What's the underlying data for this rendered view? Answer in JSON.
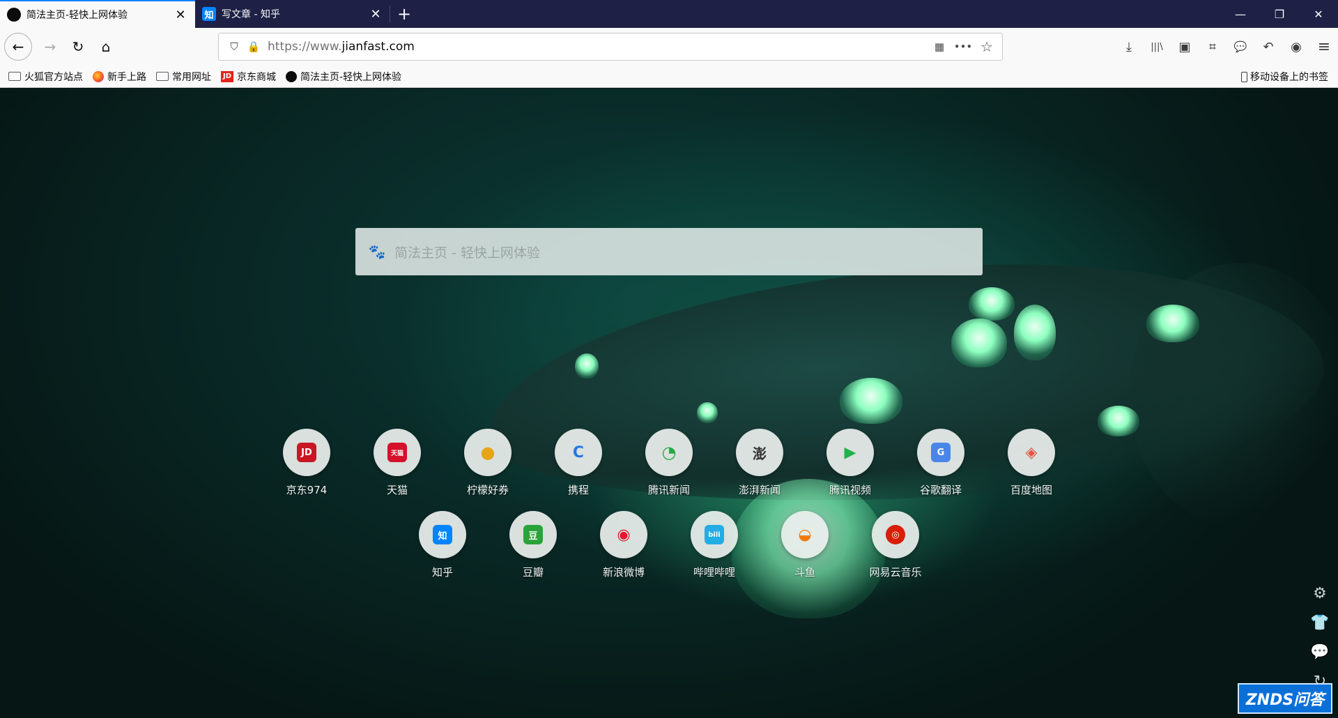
{
  "tabs": [
    {
      "title": "简法主页-轻快上网体验",
      "favicon": "jianfa-icon",
      "favicon_text": "",
      "active": true
    },
    {
      "title": "写文章 - 知乎",
      "favicon": "zhihu-icon",
      "favicon_text": "知",
      "active": false
    }
  ],
  "tab_close_glyph": "✕",
  "new_tab_glyph": "+",
  "window_controls": {
    "minimize": "—",
    "restore": "❐",
    "close": "✕"
  },
  "nav": {
    "back": "←",
    "forward": "→",
    "reload": "↻",
    "home": "⌂",
    "url_prefix": "https://www.",
    "url_domain": "jianfast.com",
    "shield": "⛉",
    "lock": "🔒",
    "qr": "▦",
    "more": "•••",
    "star": "☆"
  },
  "toolbar_right": {
    "download": "⤓",
    "library": "|||\\",
    "sidebar": "▣",
    "crop": "⌗",
    "chat": "💬",
    "undo": "↶",
    "account": "◉",
    "menu": "≡"
  },
  "bookmarks": [
    {
      "label": "火狐官方站点",
      "icon": "folder-icon",
      "icon_text": ""
    },
    {
      "label": "新手上路",
      "icon": "firefox-icon",
      "icon_text": ""
    },
    {
      "label": "常用网址",
      "icon": "folder-icon",
      "icon_text": ""
    },
    {
      "label": "京东商城",
      "icon": "jd-icon",
      "icon_text": "JD"
    },
    {
      "label": "简法主页-轻快上网体验",
      "icon": "jianfa-icon",
      "icon_text": ""
    }
  ],
  "mobile_bookmarks": "移动设备上的书签",
  "search": {
    "placeholder": "简法主页 - 轻快上网体验",
    "paw": "🐾"
  },
  "sites_row1": [
    {
      "label": "京东974",
      "glyph": "JD",
      "color": "#c81623"
    },
    {
      "label": "天猫",
      "glyph": "天猫",
      "color": "#d5102a"
    },
    {
      "label": "柠檬好券",
      "glyph": "●",
      "color": "#e6a516"
    },
    {
      "label": "携程",
      "glyph": "C",
      "color": "#2577e3"
    },
    {
      "label": "腾讯新闻",
      "glyph": "◔",
      "color": "#27a745"
    },
    {
      "label": "澎湃新闻",
      "glyph": "澎",
      "color": "#333333"
    },
    {
      "label": "腾讯视频",
      "glyph": "▶",
      "color": "#20b24b"
    },
    {
      "label": "谷歌翻译",
      "glyph": "G",
      "color": "#4a86e8"
    },
    {
      "label": "百度地图",
      "glyph": "◈",
      "color": "#e5533d"
    }
  ],
  "sites_row2": [
    {
      "label": "知乎",
      "glyph": "知",
      "color": "#0084ff"
    },
    {
      "label": "豆瓣",
      "glyph": "豆",
      "color": "#2aa33a"
    },
    {
      "label": "新浪微博",
      "glyph": "◉",
      "color": "#e6162d"
    },
    {
      "label": "哔哩哔哩",
      "glyph": "bili",
      "color": "#23ade5"
    },
    {
      "label": "斗鱼",
      "glyph": "◒",
      "color": "#f07a10"
    },
    {
      "label": "网易云音乐",
      "glyph": "◎",
      "color": "#d81e06"
    }
  ],
  "side_tools": {
    "settings": "⚙",
    "skin": "👕",
    "feedback": "💬",
    "refresh": "↻"
  },
  "watermark": "ZNDS问答"
}
